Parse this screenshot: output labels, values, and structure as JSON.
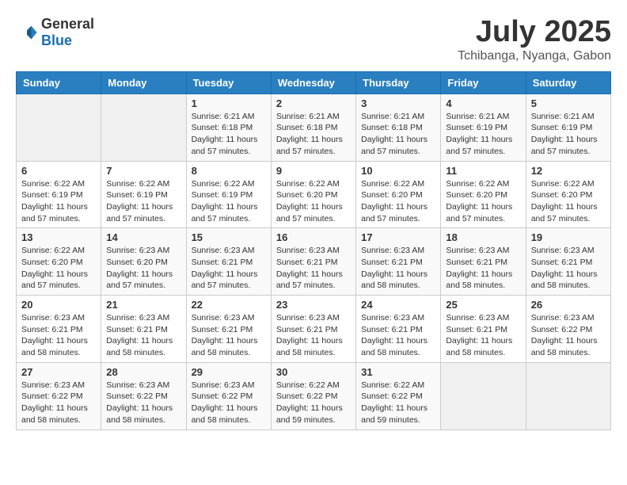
{
  "logo": {
    "general": "General",
    "blue": "Blue"
  },
  "title": {
    "month_year": "July 2025",
    "location": "Tchibanga, Nyanga, Gabon"
  },
  "headers": [
    "Sunday",
    "Monday",
    "Tuesday",
    "Wednesday",
    "Thursday",
    "Friday",
    "Saturday"
  ],
  "weeks": [
    [
      {
        "day": "",
        "info": ""
      },
      {
        "day": "",
        "info": ""
      },
      {
        "day": "1",
        "info": "Sunrise: 6:21 AM\nSunset: 6:18 PM\nDaylight: 11 hours and 57 minutes."
      },
      {
        "day": "2",
        "info": "Sunrise: 6:21 AM\nSunset: 6:18 PM\nDaylight: 11 hours and 57 minutes."
      },
      {
        "day": "3",
        "info": "Sunrise: 6:21 AM\nSunset: 6:18 PM\nDaylight: 11 hours and 57 minutes."
      },
      {
        "day": "4",
        "info": "Sunrise: 6:21 AM\nSunset: 6:19 PM\nDaylight: 11 hours and 57 minutes."
      },
      {
        "day": "5",
        "info": "Sunrise: 6:21 AM\nSunset: 6:19 PM\nDaylight: 11 hours and 57 minutes."
      }
    ],
    [
      {
        "day": "6",
        "info": "Sunrise: 6:22 AM\nSunset: 6:19 PM\nDaylight: 11 hours and 57 minutes."
      },
      {
        "day": "7",
        "info": "Sunrise: 6:22 AM\nSunset: 6:19 PM\nDaylight: 11 hours and 57 minutes."
      },
      {
        "day": "8",
        "info": "Sunrise: 6:22 AM\nSunset: 6:19 PM\nDaylight: 11 hours and 57 minutes."
      },
      {
        "day": "9",
        "info": "Sunrise: 6:22 AM\nSunset: 6:20 PM\nDaylight: 11 hours and 57 minutes."
      },
      {
        "day": "10",
        "info": "Sunrise: 6:22 AM\nSunset: 6:20 PM\nDaylight: 11 hours and 57 minutes."
      },
      {
        "day": "11",
        "info": "Sunrise: 6:22 AM\nSunset: 6:20 PM\nDaylight: 11 hours and 57 minutes."
      },
      {
        "day": "12",
        "info": "Sunrise: 6:22 AM\nSunset: 6:20 PM\nDaylight: 11 hours and 57 minutes."
      }
    ],
    [
      {
        "day": "13",
        "info": "Sunrise: 6:22 AM\nSunset: 6:20 PM\nDaylight: 11 hours and 57 minutes."
      },
      {
        "day": "14",
        "info": "Sunrise: 6:23 AM\nSunset: 6:20 PM\nDaylight: 11 hours and 57 minutes."
      },
      {
        "day": "15",
        "info": "Sunrise: 6:23 AM\nSunset: 6:21 PM\nDaylight: 11 hours and 57 minutes."
      },
      {
        "day": "16",
        "info": "Sunrise: 6:23 AM\nSunset: 6:21 PM\nDaylight: 11 hours and 57 minutes."
      },
      {
        "day": "17",
        "info": "Sunrise: 6:23 AM\nSunset: 6:21 PM\nDaylight: 11 hours and 58 minutes."
      },
      {
        "day": "18",
        "info": "Sunrise: 6:23 AM\nSunset: 6:21 PM\nDaylight: 11 hours and 58 minutes."
      },
      {
        "day": "19",
        "info": "Sunrise: 6:23 AM\nSunset: 6:21 PM\nDaylight: 11 hours and 58 minutes."
      }
    ],
    [
      {
        "day": "20",
        "info": "Sunrise: 6:23 AM\nSunset: 6:21 PM\nDaylight: 11 hours and 58 minutes."
      },
      {
        "day": "21",
        "info": "Sunrise: 6:23 AM\nSunset: 6:21 PM\nDaylight: 11 hours and 58 minutes."
      },
      {
        "day": "22",
        "info": "Sunrise: 6:23 AM\nSunset: 6:21 PM\nDaylight: 11 hours and 58 minutes."
      },
      {
        "day": "23",
        "info": "Sunrise: 6:23 AM\nSunset: 6:21 PM\nDaylight: 11 hours and 58 minutes."
      },
      {
        "day": "24",
        "info": "Sunrise: 6:23 AM\nSunset: 6:21 PM\nDaylight: 11 hours and 58 minutes."
      },
      {
        "day": "25",
        "info": "Sunrise: 6:23 AM\nSunset: 6:21 PM\nDaylight: 11 hours and 58 minutes."
      },
      {
        "day": "26",
        "info": "Sunrise: 6:23 AM\nSunset: 6:22 PM\nDaylight: 11 hours and 58 minutes."
      }
    ],
    [
      {
        "day": "27",
        "info": "Sunrise: 6:23 AM\nSunset: 6:22 PM\nDaylight: 11 hours and 58 minutes."
      },
      {
        "day": "28",
        "info": "Sunrise: 6:23 AM\nSunset: 6:22 PM\nDaylight: 11 hours and 58 minutes."
      },
      {
        "day": "29",
        "info": "Sunrise: 6:23 AM\nSunset: 6:22 PM\nDaylight: 11 hours and 58 minutes."
      },
      {
        "day": "30",
        "info": "Sunrise: 6:22 AM\nSunset: 6:22 PM\nDaylight: 11 hours and 59 minutes."
      },
      {
        "day": "31",
        "info": "Sunrise: 6:22 AM\nSunset: 6:22 PM\nDaylight: 11 hours and 59 minutes."
      },
      {
        "day": "",
        "info": ""
      },
      {
        "day": "",
        "info": ""
      }
    ]
  ]
}
